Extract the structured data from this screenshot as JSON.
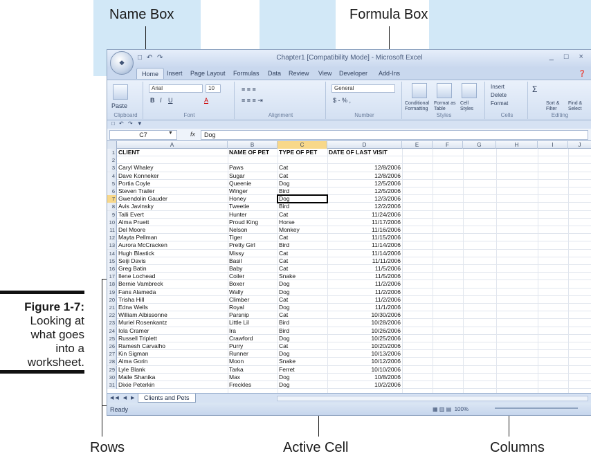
{
  "callouts": {
    "name_box": "Name Box",
    "formula_box": "Formula Box",
    "rows": "Rows",
    "active_cell": "Active Cell",
    "columns": "Columns"
  },
  "caption": {
    "figure": "Figure 1-7:",
    "text_lines": [
      "Looking at",
      "what goes",
      "into a",
      "worksheet."
    ]
  },
  "window": {
    "title": "Chapter1 [Compatibility Mode] - Microsoft Excel",
    "office_button": "Office",
    "tabs": [
      "Home",
      "Insert",
      "Page Layout",
      "Formulas",
      "Data",
      "Review",
      "View",
      "Developer",
      "Add-Ins"
    ]
  },
  "ribbon": {
    "clipboard": {
      "paste": "Paste",
      "label": "Clipboard"
    },
    "font": {
      "name": "Arial",
      "size": "10",
      "label": "Font"
    },
    "alignment": {
      "label": "Alignment"
    },
    "number": {
      "format": "General",
      "label": "Number",
      "currency": "$ - % ,"
    },
    "styles": {
      "conditional": "Conditional Formatting",
      "format_table": "Format as Table",
      "cell_styles": "Cell Styles",
      "label": "Styles"
    },
    "cells": {
      "insert": "Insert",
      "delete": "Delete",
      "format": "Format",
      "label": "Cells"
    },
    "editing": {
      "sort": "Sort & Filter",
      "find": "Find & Select",
      "label": "Editing"
    }
  },
  "formula_bar": {
    "name_box_value": "C7",
    "fx": "fx",
    "formula_value": "Dog"
  },
  "columns": [
    "A",
    "B",
    "C",
    "D",
    "E",
    "F",
    "G",
    "H",
    "I",
    "J"
  ],
  "headers": {
    "client": "CLIENT",
    "pet_name": "NAME OF PET",
    "pet_type": "TYPE OF PET",
    "last_visit": "DATE OF LAST VISIT"
  },
  "rows": [
    {
      "n": "1",
      "client": "",
      "name": "",
      "type": "",
      "date": ""
    },
    {
      "n": "2",
      "client": "",
      "name": "",
      "type": "",
      "date": ""
    },
    {
      "n": "3",
      "client": "Caryl Whaley",
      "name": "Paws",
      "type": "Cat",
      "date": "12/8/2006"
    },
    {
      "n": "4",
      "client": "Dave Konneker",
      "name": "Sugar",
      "type": "Cat",
      "date": "12/8/2006"
    },
    {
      "n": "5",
      "client": "Portia Coyle",
      "name": "Queenie",
      "type": "Dog",
      "date": "12/5/2006"
    },
    {
      "n": "6",
      "client": "Steven Trailer",
      "name": "Winger",
      "type": "Bird",
      "date": "12/5/2006"
    },
    {
      "n": "7",
      "client": "Gwendolin Gauder",
      "name": "Honey",
      "type": "Dog",
      "date": "12/3/2006"
    },
    {
      "n": "8",
      "client": "Avis Javinsky",
      "name": "Tweetie",
      "type": "Bird",
      "date": "12/2/2006"
    },
    {
      "n": "9",
      "client": "Talli Evert",
      "name": "Hunter",
      "type": "Cat",
      "date": "11/24/2006"
    },
    {
      "n": "10",
      "client": "Alma Pruett",
      "name": "Proud King",
      "type": "Horse",
      "date": "11/17/2006"
    },
    {
      "n": "11",
      "client": "Del Moore",
      "name": "Nelson",
      "type": "Monkey",
      "date": "11/16/2006"
    },
    {
      "n": "12",
      "client": "Mayta Pellman",
      "name": "Tiger",
      "type": "Cat",
      "date": "11/15/2006"
    },
    {
      "n": "13",
      "client": "Aurora McCracken",
      "name": "Pretty Girl",
      "type": "Bird",
      "date": "11/14/2006"
    },
    {
      "n": "14",
      "client": "Hugh Blastick",
      "name": "Missy",
      "type": "Cat",
      "date": "11/14/2006"
    },
    {
      "n": "15",
      "client": "Seiji Davis",
      "name": "Basil",
      "type": "Cat",
      "date": "11/11/2006"
    },
    {
      "n": "16",
      "client": "Greg Batin",
      "name": "Baby",
      "type": "Cat",
      "date": "11/5/2006"
    },
    {
      "n": "17",
      "client": "Ilene Lochead",
      "name": "Coiler",
      "type": "Snake",
      "date": "11/5/2006"
    },
    {
      "n": "18",
      "client": "Bernie Vambreck",
      "name": "Boxer",
      "type": "Dog",
      "date": "11/2/2006"
    },
    {
      "n": "19",
      "client": "Fans Alameda",
      "name": "Wally",
      "type": "Dog",
      "date": "11/2/2006"
    },
    {
      "n": "20",
      "client": "Trisha Hill",
      "name": "Climber",
      "type": "Cat",
      "date": "11/2/2006"
    },
    {
      "n": "21",
      "client": "Edna Wells",
      "name": "Royal",
      "type": "Dog",
      "date": "11/1/2006"
    },
    {
      "n": "22",
      "client": "William Albissonne",
      "name": "Parsnip",
      "type": "Cat",
      "date": "10/30/2006"
    },
    {
      "n": "23",
      "client": "Muriel Rosenkantz",
      "name": "Little Lil",
      "type": "Bird",
      "date": "10/28/2006"
    },
    {
      "n": "24",
      "client": "Iola Cramer",
      "name": "Ira",
      "type": "Bird",
      "date": "10/26/2006"
    },
    {
      "n": "25",
      "client": "Russell Triplett",
      "name": "Crawford",
      "type": "Dog",
      "date": "10/25/2006"
    },
    {
      "n": "26",
      "client": "Ramesh Carvalho",
      "name": "Purry",
      "type": "Cat",
      "date": "10/20/2006"
    },
    {
      "n": "27",
      "client": "Kin Sigman",
      "name": "Runner",
      "type": "Dog",
      "date": "10/13/2006"
    },
    {
      "n": "28",
      "client": "Alma Gorin",
      "name": "Moon",
      "type": "Snake",
      "date": "10/12/2006"
    },
    {
      "n": "29",
      "client": "Lyle Blank",
      "name": "Tarka",
      "type": "Ferret",
      "date": "10/10/2006"
    },
    {
      "n": "30",
      "client": "Maile Shanika",
      "name": "Max",
      "type": "Dog",
      "date": "10/8/2006"
    },
    {
      "n": "31",
      "client": "Dixie Peterkin",
      "name": "Freckles",
      "type": "Dog",
      "date": "10/2/2006"
    }
  ],
  "sheet_tab": "Clients and Pets",
  "status": {
    "mode": "Ready",
    "zoom": "100%"
  }
}
